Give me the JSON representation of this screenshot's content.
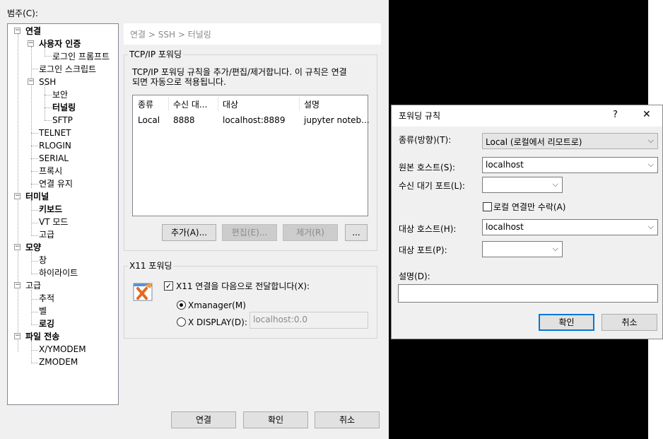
{
  "main_dialog": {
    "category_label": "범주(C):",
    "tree": [
      {
        "label": "연결",
        "bold": true,
        "expander": "-"
      },
      {
        "label": "사용자 인증",
        "bold": true,
        "expander": "-"
      },
      {
        "label": "로그인 프롬프트",
        "bold": true
      },
      {
        "label": "로그인 스크립트",
        "bold": false
      },
      {
        "label": "SSH",
        "bold": false,
        "expander": "-"
      },
      {
        "label": "보안",
        "bold": false
      },
      {
        "label": "터널링",
        "bold": true
      },
      {
        "label": "SFTP",
        "bold": false
      },
      {
        "label": "TELNET",
        "bold": false
      },
      {
        "label": "RLOGIN",
        "bold": false
      },
      {
        "label": "SERIAL",
        "bold": false
      },
      {
        "label": "프록시",
        "bold": false
      },
      {
        "label": "연결 유지",
        "bold": false
      },
      {
        "label": "터미널",
        "bold": true,
        "expander": "-"
      },
      {
        "label": "키보드",
        "bold": true
      },
      {
        "label": "VT 모드",
        "bold": false
      },
      {
        "label": "고급",
        "bold": false
      },
      {
        "label": "모양",
        "bold": true,
        "expander": "-"
      },
      {
        "label": "창",
        "bold": false
      },
      {
        "label": "하이라이트",
        "bold": false
      },
      {
        "label": "고급",
        "bold": false,
        "expander": "-"
      },
      {
        "label": "추적",
        "bold": false
      },
      {
        "label": "벨",
        "bold": false
      },
      {
        "label": "로깅",
        "bold": true
      },
      {
        "label": "파일 전송",
        "bold": true,
        "expander": "-"
      },
      {
        "label": "X/YMODEM",
        "bold": false
      },
      {
        "label": "ZMODEM",
        "bold": false
      }
    ],
    "breadcrumb": "연결 > SSH > 터널링",
    "tcpip": {
      "title": "TCP/IP 포워딩",
      "description_line1": "TCP/IP 포워딩 규칙을 추가/편집/제거합니다. 이 규칙은 연결",
      "description_line2": "되면 자동으로 적용됩니다.",
      "columns": [
        "종류",
        "수신 대...",
        "대상",
        "설명"
      ],
      "rows": [
        [
          "Local",
          "8888",
          "localhost:8889",
          "jupyter noteb..."
        ]
      ],
      "add_button": "추가(A)...",
      "edit_button": "편집(E)...",
      "remove_button": "제거(R)",
      "more_button": "..."
    },
    "x11": {
      "title": "X11 포워딩",
      "forward_checkbox": "X11 연결을 다음으로 전달합니다(X):",
      "forward_checked": true,
      "radio_xmanager": "Xmanager(M)",
      "radio_xdisplay": "X DISPLAY(D):",
      "selected": "xmanager",
      "xdisplay_value": "localhost:0.0"
    },
    "footer": {
      "connect_button": "연결",
      "ok_button": "확인",
      "cancel_button": "취소"
    }
  },
  "rule_dialog": {
    "title": "포워딩 규칙",
    "help_glyph": "?",
    "close_glyph": "✕",
    "type_label": "종류(방향)(T):",
    "type_value": "Local (로컬에서 리모트로)",
    "source_host_label": "원본 호스트(S):",
    "source_host_value": "localhost",
    "listen_port_label": "수신 대기 포트(L):",
    "listen_port_value": "",
    "local_only_label": "로컬 연결만 수락(A)",
    "local_only_checked": false,
    "dest_host_label": "대상 호스트(H):",
    "dest_host_value": "localhost",
    "dest_port_label": "대상 포트(P):",
    "dest_port_value": "",
    "description_label": "설명(D):",
    "description_value": "",
    "ok_button": "확인",
    "cancel_button": "취소"
  },
  "colors": {
    "dialog_bg": "#f0f0f0",
    "desktop_bg": "#000000",
    "accent": "#0078d7"
  }
}
